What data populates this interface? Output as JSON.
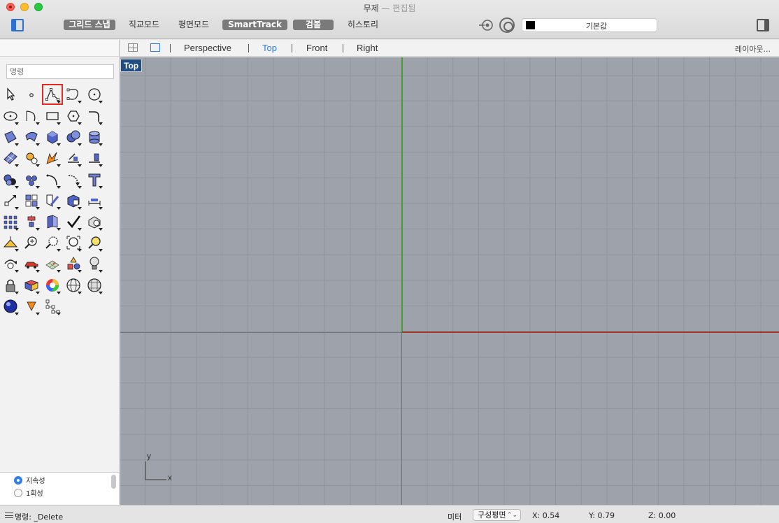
{
  "window": {
    "title": "무제",
    "title_suffix": "— 편집됨"
  },
  "toolbar": {
    "modes": [
      {
        "label": "그리드 스냅",
        "on": true
      },
      {
        "label": "직교모드",
        "on": false
      },
      {
        "label": "평면모드",
        "on": false
      },
      {
        "label": "SmartTrack",
        "on": true
      },
      {
        "label": "검볼",
        "on": true
      },
      {
        "label": "히스토리",
        "on": false
      }
    ],
    "layer": "기본값",
    "layer_color": "#000000"
  },
  "sidebar": {
    "command_placeholder": "명령",
    "tools": [
      "select-arrow-icon",
      "point-icon",
      "polyline-icon",
      "curve-icon",
      "circle-icon",
      "ellipse-icon",
      "arc-icon",
      "rectangle-icon",
      "polygon-icon",
      "fillet-curve-icon",
      "surface-corner-icon",
      "loft-surface-icon",
      "box-icon",
      "boolean-solid-icon",
      "cylinder-icon",
      "mesh-plane-icon",
      "transform-gear-icon",
      "explode-icon",
      "extend-icon",
      "offset-icon",
      "boolean-union-icon",
      "points-cluster-icon",
      "curve-tangent-icon",
      "rotate-icon",
      "text-icon",
      "move-icon",
      "group-icon",
      "edit-surface-icon",
      "solid-cube-icon",
      "dimension-icon",
      "array-grid-icon",
      "align-icon",
      "unroll-icon",
      "check-icon",
      "analyze-icon",
      "render-light-icon",
      "zoom-icon",
      "zoom-window-icon",
      "zoom-extents-icon",
      "zoom-selected-icon",
      "rotate-view-icon",
      "car-icon",
      "terrain-mesh-icon",
      "shapes-icon",
      "light-bulb-icon",
      "lock-icon",
      "layer-book-icon",
      "color-wheel-icon",
      "sphere-wire-icon",
      "sphere-grid-icon",
      "material-ball-icon",
      "spotlight-icon",
      "tree-diagram-icon"
    ],
    "selected_tool": "polyline-icon",
    "history": {
      "options": [
        {
          "label": "지속성",
          "on": true
        },
        {
          "label": "1회성",
          "on": false
        }
      ]
    }
  },
  "viewports": {
    "tabs": [
      {
        "label": "Perspective",
        "active": false
      },
      {
        "label": "Top",
        "active": true
      },
      {
        "label": "Front",
        "active": false
      },
      {
        "label": "Right",
        "active": false
      }
    ],
    "layout_label": "레이아웃...",
    "active_label": "Top",
    "gizmo": {
      "x": "x",
      "y": "y"
    }
  },
  "status": {
    "command": "명령: _Delete",
    "units": "미터",
    "cplane": "구성평면",
    "x": "X: 0.54",
    "y": "Y: 0.79",
    "z": "Z: 0.00"
  }
}
